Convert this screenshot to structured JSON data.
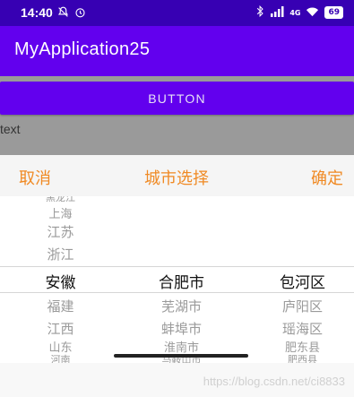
{
  "status_bar": {
    "time": "14:40",
    "battery": "69",
    "network": "4G",
    "icons": [
      "notifications-off-icon",
      "alarm-icon",
      "bluetooth-icon",
      "signal-icon",
      "wifi-icon",
      "battery-icon"
    ]
  },
  "app_bar": {
    "title": "MyApplication25"
  },
  "main": {
    "button_label": "BUTTON",
    "text_view": "text"
  },
  "picker": {
    "cancel_label": "取消",
    "title": "城市选择",
    "confirm_label": "确定",
    "provinces": {
      "above": [
        "黑龙江",
        "上海",
        "江苏",
        "浙江"
      ],
      "selected": "安徽",
      "below": [
        "福建",
        "江西",
        "山东",
        "河南"
      ]
    },
    "cities": {
      "above": [],
      "selected": "合肥市",
      "below": [
        "芜湖市",
        "蚌埠市",
        "淮南市",
        "马鞍山市"
      ]
    },
    "districts": {
      "above": [],
      "selected": "包河区",
      "below": [
        "庐阳区",
        "瑶海区",
        "肥东县",
        "肥西县"
      ]
    }
  },
  "watermark": "https://blog.csdn.net/ci8833",
  "colors": {
    "status_bar": "#3700b3",
    "primary": "#6200ee",
    "accent": "#f08a24",
    "overlay": "#9a9a9a"
  }
}
